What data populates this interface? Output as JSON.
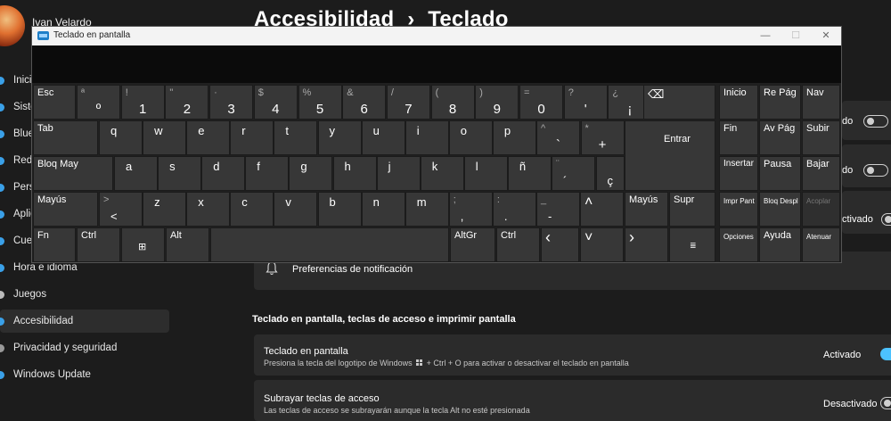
{
  "settings": {
    "user_name": "Ivan Velardo",
    "breadcrumb_parent": "Accesibilidad",
    "breadcrumb_sep": "›",
    "breadcrumb_current": "Teclado",
    "nav": [
      {
        "label": "Inicio"
      },
      {
        "label": "Sistema"
      },
      {
        "label": "Bluetooth y dispositivos"
      },
      {
        "label": "Red e Internet"
      },
      {
        "label": "Personalización"
      },
      {
        "label": "Aplicaciones"
      },
      {
        "label": "Cuentas"
      },
      {
        "label": "Hora e idioma"
      },
      {
        "label": "Juegos"
      },
      {
        "label": "Accesibilidad"
      },
      {
        "label": "Privacidad y seguridad"
      },
      {
        "label": "Windows Update"
      }
    ],
    "right_fragments": {
      "row1": "do",
      "row2": "do",
      "row3": "ctivado"
    },
    "notification_pref": "Preferencias de notificación",
    "section_title": "Teclado en pantalla, teclas de acceso e imprimir pantalla",
    "rows": [
      {
        "title": "Teclado en pantalla",
        "desc_before": "Presiona la tecla del logotipo de Windows",
        "desc_after": "+ Ctrl + O para activar o desactivar el teclado en pantalla",
        "state": "Activado",
        "on": true
      },
      {
        "title": "Subrayar teclas de acceso",
        "desc_before": "Las teclas de acceso se subrayarán aunque la tecla Alt no esté presionada",
        "desc_after": "",
        "state": "Desactivado",
        "on": false
      }
    ]
  },
  "osk": {
    "title": "Teclado en pantalla",
    "window_buttons": {
      "minimize": "—",
      "maximize": "☐",
      "close": "✕"
    },
    "row1": [
      {
        "shift": "ª",
        "main": "º"
      },
      {
        "shift": "!",
        "main": "1"
      },
      {
        "shift": "\"",
        "main": "2"
      },
      {
        "shift": "·",
        "main": "3"
      },
      {
        "shift": "$",
        "main": "4"
      },
      {
        "shift": "%",
        "main": "5"
      },
      {
        "shift": "&",
        "main": "6"
      },
      {
        "shift": "/",
        "main": "7"
      },
      {
        "shift": "(",
        "main": "8"
      },
      {
        "shift": ")",
        "main": "9"
      },
      {
        "shift": "=",
        "main": "0"
      },
      {
        "shift": "?",
        "main": "'"
      },
      {
        "shift": "¿",
        "main": "¡"
      }
    ],
    "row2": [
      "q",
      "w",
      "e",
      "r",
      "t",
      "y",
      "u",
      "i",
      "o",
      "p"
    ],
    "row2_extra": [
      {
        "shift": "^",
        "main": "`"
      },
      {
        "shift": "*",
        "main": "+"
      }
    ],
    "row3": [
      "a",
      "s",
      "d",
      "f",
      "g",
      "h",
      "j",
      "k",
      "l",
      "ñ"
    ],
    "row3_extra": [
      {
        "shift": "¨",
        "main": "´"
      },
      {
        "shift": "",
        "main": "ç"
      }
    ],
    "row4": [
      {
        "shift": ">",
        "main": "<"
      },
      {
        "shift": "",
        "main": "z"
      },
      {
        "shift": "",
        "main": "x"
      },
      {
        "shift": "",
        "main": "c"
      },
      {
        "shift": "",
        "main": "v"
      },
      {
        "shift": "",
        "main": "b"
      },
      {
        "shift": "",
        "main": "n"
      },
      {
        "shift": "",
        "main": "m"
      },
      {
        "shift": ";",
        "main": ","
      },
      {
        "shift": ":",
        "main": "."
      },
      {
        "shift": "_",
        "main": "-"
      }
    ],
    "labels": {
      "esc": "Esc",
      "backspace": "⌫",
      "tab": "Tab",
      "enter": "Entrar",
      "caps": "Bloq May",
      "shift_l": "Mayús",
      "shift_r": "Mayús",
      "supr": "Supr",
      "fn": "Fn",
      "ctrl_l": "Ctrl",
      "alt": "Alt",
      "altgr": "AltGr",
      "ctrl_r": "Ctrl",
      "up": "˄",
      "down": "˅",
      "left": "‹",
      "right": "›",
      "inicio": "Inicio",
      "repag": "Re Pág",
      "nav": "Nav",
      "fin": "Fin",
      "avpag": "Av Pág",
      "subir": "Subir",
      "insertar": "Insertar",
      "pausa": "Pausa",
      "bajar": "Bajar",
      "imprpant": "Impr Pant",
      "bloqdespl": "Bloq Despl",
      "acoplar": "Acoplar",
      "opciones": "Opciones",
      "ayuda": "Ayuda",
      "atenuar": "Atenuar",
      "win_glyph": "⊞",
      "menu_glyph": "≣"
    }
  }
}
